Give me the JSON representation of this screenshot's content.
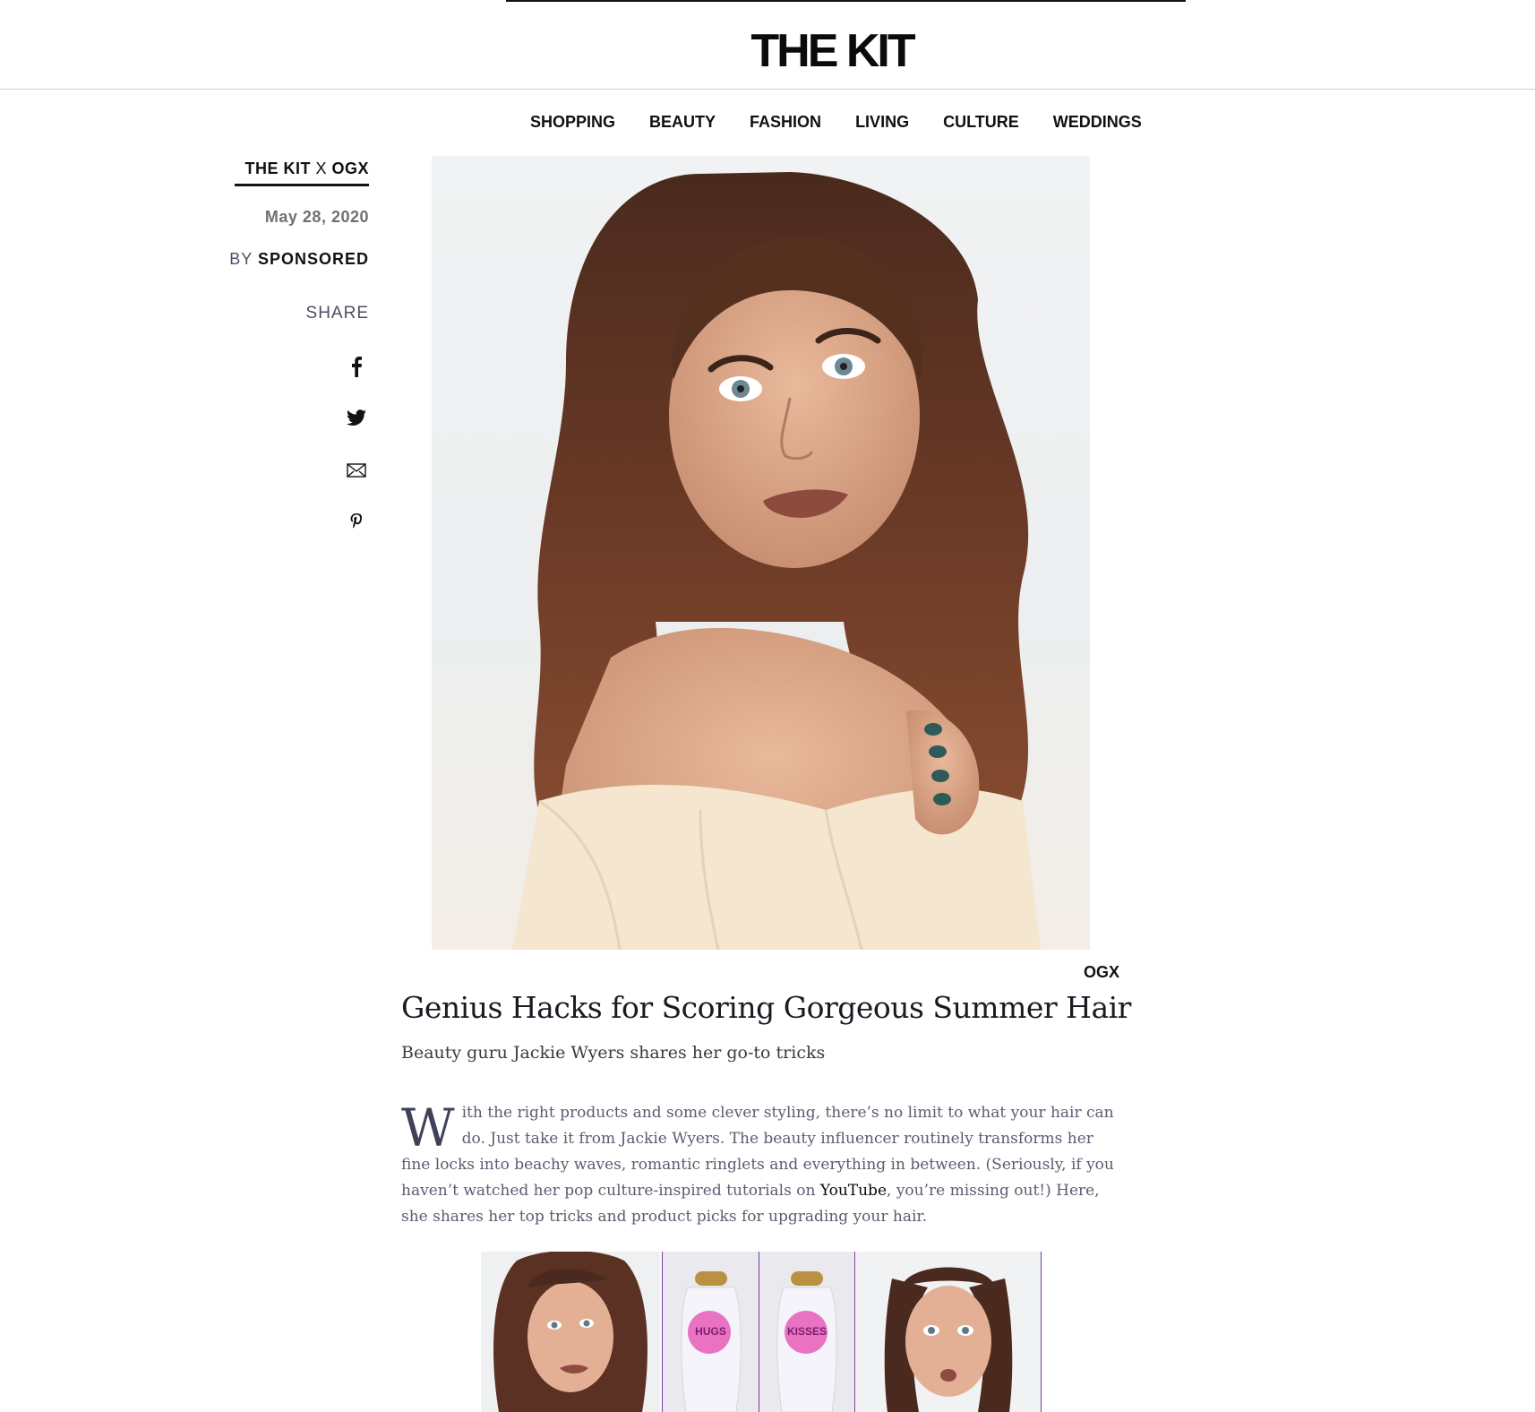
{
  "brand": {
    "logo": "THE KIT"
  },
  "nav": {
    "items": [
      "SHOPPING",
      "BEAUTY",
      "FASHION",
      "LIVING",
      "CULTURE",
      "WEDDINGS"
    ]
  },
  "article_meta": {
    "sponsor_tag_main": "THE KIT",
    "sponsor_tag_x": " X ",
    "sponsor_tag_partner": "OGX",
    "date": "May 28, 2020",
    "by_label": "BY ",
    "author": "SPONSORED",
    "share_label": "SHARE",
    "share_icons": [
      "facebook-icon",
      "twitter-icon",
      "email-icon",
      "pinterest-icon"
    ]
  },
  "hero": {
    "credit": "OGX"
  },
  "article": {
    "headline": "Genius Hacks for Scoring Gorgeous Summer Hair",
    "dek": "Beauty guru Jackie Wyers shares her go-to tricks",
    "dropcap": "W",
    "body_part1": "ith the right products and some clever styling, there’s no limit to what your hair can do. Just take it from Jackie Wyers. The beauty influencer routinely transforms her fine locks into beachy waves, romantic ringlets and everything in between. (Seriously, if you haven’t watched her pop culture-inspired tutorials on ",
    "body_link": "YouTube",
    "body_part2": ", you’re missing out!) Here, she shares her top tricks and product picks for upgrading your hair."
  },
  "collage": {
    "bottle_1_label": "HUGS",
    "bottle_2_label": "KISSES"
  },
  "colors": {
    "accent": "#111111",
    "meta_gray": "#707070",
    "slate": "#4b4f63",
    "purple": "#7a3ba0",
    "pink": "#e85bb8"
  }
}
